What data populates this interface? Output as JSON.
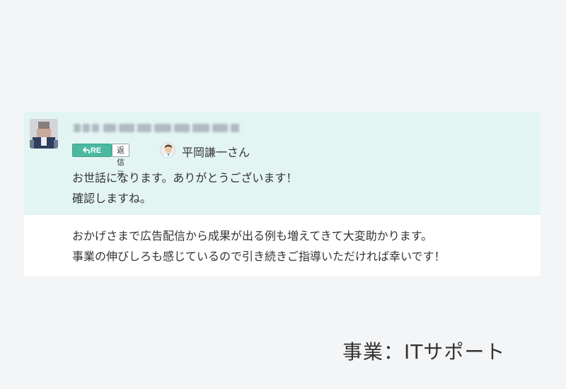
{
  "message": {
    "reply_badge": "RE",
    "reply_source_label": "返信元",
    "reply_to_name": "平岡謙一さん",
    "lines": [
      "お世話になります。ありがとうございます！",
      "確認しますね。"
    ]
  },
  "followup": {
    "lines": [
      "おかげさまで広告配信から成果が出る例も増えてきて大変助かります。",
      "事業の伸びしろも感じているので引き続きご指導いただければ幸いです！"
    ]
  },
  "caption": "事業：ITサポート",
  "colors": {
    "page_background": "#f4f5f7",
    "highlight_background": "#e2f5f3",
    "message_background": "#ffffff",
    "re_badge_green": "#4cb8a0",
    "text": "#333333"
  },
  "icons": {
    "reply": "reply-arrow-icon"
  }
}
